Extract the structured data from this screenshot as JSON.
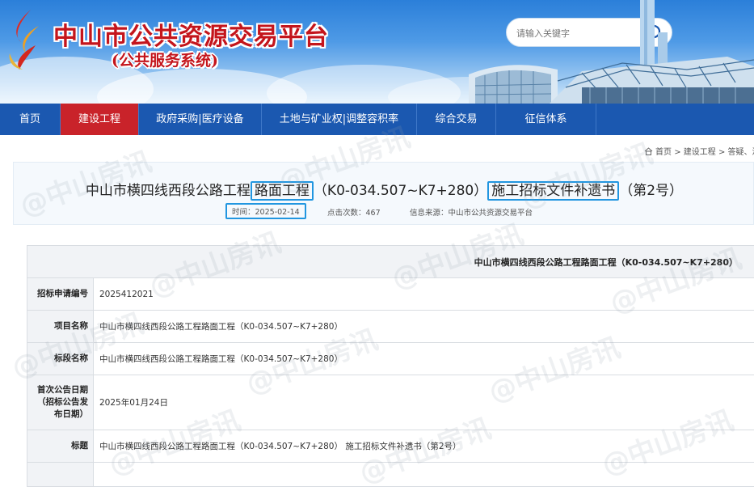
{
  "header": {
    "title": "中山市公共资源交易平台",
    "subtitle": "(公共服务系统)",
    "search_placeholder": "请输入关键字"
  },
  "nav": {
    "items": [
      {
        "label": "首页"
      },
      {
        "label": "建设工程"
      },
      {
        "label": "政府采购|医疗设备"
      },
      {
        "label": "土地与矿业权|调整容积率"
      },
      {
        "label": "综合交易"
      },
      {
        "label": "征信体系"
      }
    ],
    "active_index": 1
  },
  "breadcrumb": {
    "home": "首页",
    "sep1": ">",
    "level1": "建设工程",
    "sep2": ">",
    "level2": "答疑、澄"
  },
  "article": {
    "title_part1": "中山市横四线西段公路工程",
    "title_part2": "路面工程",
    "title_part3": "（K0-034.507~K7+280）",
    "title_part4": "施工招标文件补遗书",
    "title_part5": "（第2号）",
    "time_label": "时间：",
    "time_value": "2025-02-14",
    "clicks_label": "点击次数：",
    "clicks_value": "467",
    "source_label": "信息来源：",
    "source_value": "中山市公共资源交易平台"
  },
  "detail": {
    "caption": "中山市横四线西段公路工程路面工程（K0-034.507~K7+280）",
    "rows": [
      {
        "label": "招标申请编号",
        "value": "2025412021"
      },
      {
        "label": "项目名称",
        "value": "中山市横四线西段公路工程路面工程（K0-034.507~K7+280）"
      },
      {
        "label": "标段名称",
        "value": "中山市横四线西段公路工程路面工程（K0-034.507~K7+280）"
      },
      {
        "label": "首次公告日期（招标公告发布日期）",
        "value": "2025年01月24日"
      },
      {
        "label": "标题",
        "value": "中山市横四线西段公路工程路面工程（K0-034.507~K7+280） 施工招标文件补遗书（第2号）"
      }
    ]
  },
  "watermark": "@中山房讯",
  "colors": {
    "nav_bg": "#1b58b0",
    "nav_active": "#c9232a",
    "title_red": "#c4151c",
    "highlight_blue": "#2196e0"
  }
}
